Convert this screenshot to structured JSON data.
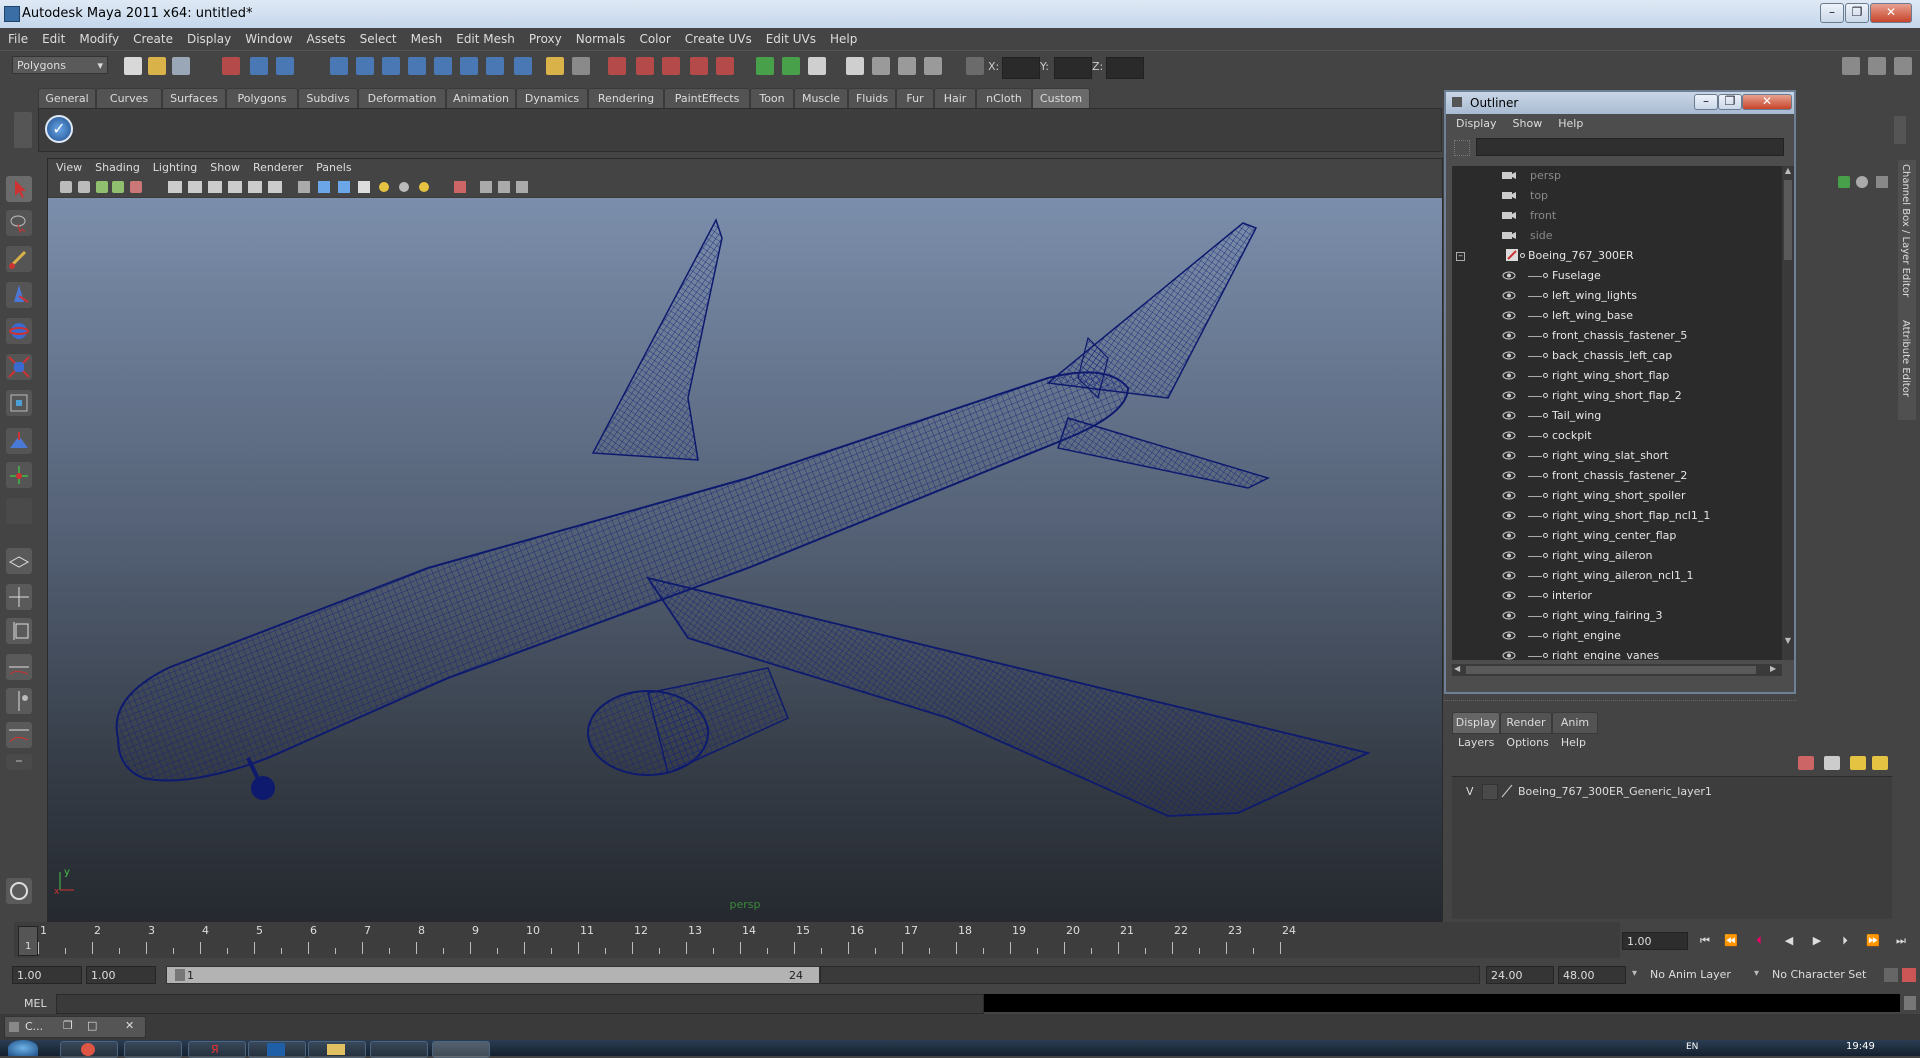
{
  "window": {
    "title": "Autodesk Maya 2011 x64: untitled*"
  },
  "menubar": [
    "File",
    "Edit",
    "Modify",
    "Create",
    "Display",
    "Window",
    "Assets",
    "Select",
    "Mesh",
    "Edit Mesh",
    "Proxy",
    "Normals",
    "Color",
    "Create UVs",
    "Edit UVs",
    "Help"
  ],
  "statusline": {
    "mode": "Polygons",
    "x_label": "X:",
    "y_label": "Y:",
    "z_label": "Z:"
  },
  "shelf_tabs": [
    "General",
    "Curves",
    "Surfaces",
    "Polygons",
    "Subdivs",
    "Deformation",
    "Animation",
    "Dynamics",
    "Rendering",
    "PaintEffects",
    "Toon",
    "Muscle",
    "Fluids",
    "Fur",
    "Hair",
    "nCloth",
    "Custom"
  ],
  "shelf_active": "Custom",
  "viewport": {
    "menu": [
      "View",
      "Shading",
      "Lighting",
      "Show",
      "Renderer",
      "Panels"
    ],
    "camera_label": "persp",
    "wire_color": "#0d1a6e"
  },
  "outliner": {
    "title": "Outliner",
    "menu": [
      "Display",
      "Show",
      "Help"
    ],
    "cameras": [
      "persp",
      "top",
      "front",
      "side"
    ],
    "root": "Boeing_767_300ER",
    "items": [
      "Fuselage",
      "left_wing_lights",
      "left_wing_base",
      "front_chassis_fastener_5",
      "back_chassis_left_cap",
      "right_wing_short_flap",
      "right_wing_short_flap_2",
      "Tail_wing",
      "cockpit",
      "right_wing_slat_short",
      "front_chassis_fastener_2",
      "right_wing_short_spoiler",
      "right_wing_short_flap_ncl1_1",
      "right_wing_center_flap",
      "right_wing_aileron",
      "right_wing_aileron_ncl1_1",
      "interior",
      "right_wing_fairing_3",
      "right_engine",
      "right_engine_vanes"
    ]
  },
  "side_tabs": [
    "Channel Box / Layer Editor",
    "Attribute Editor"
  ],
  "layer_editor": {
    "tabs": [
      "Display",
      "Render",
      "Anim"
    ],
    "menu": [
      "Layers",
      "Options",
      "Help"
    ],
    "layer_visible": "V",
    "layer_name": "Boeing_767_300ER_Generic_layer1"
  },
  "timeline": {
    "ticks": [
      "1",
      "2",
      "3",
      "4",
      "5",
      "6",
      "7",
      "8",
      "9",
      "10",
      "11",
      "12",
      "13",
      "14",
      "15",
      "16",
      "17",
      "18",
      "19",
      "20",
      "21",
      "22",
      "23",
      "24"
    ],
    "current_marker": "1",
    "current_frame": "1.00"
  },
  "range": {
    "start_time": "1.00",
    "playback_start": "1.00",
    "slider_start": "1",
    "slider_end": "24",
    "playback_end": "24.00",
    "end_time": "48.00",
    "anim_layer": "No Anim Layer",
    "char_set": "No Character Set"
  },
  "command": {
    "label": "MEL"
  },
  "minimized": {
    "label": "C..."
  },
  "taskbar": {
    "clock": "19:49",
    "lang": "EN"
  }
}
